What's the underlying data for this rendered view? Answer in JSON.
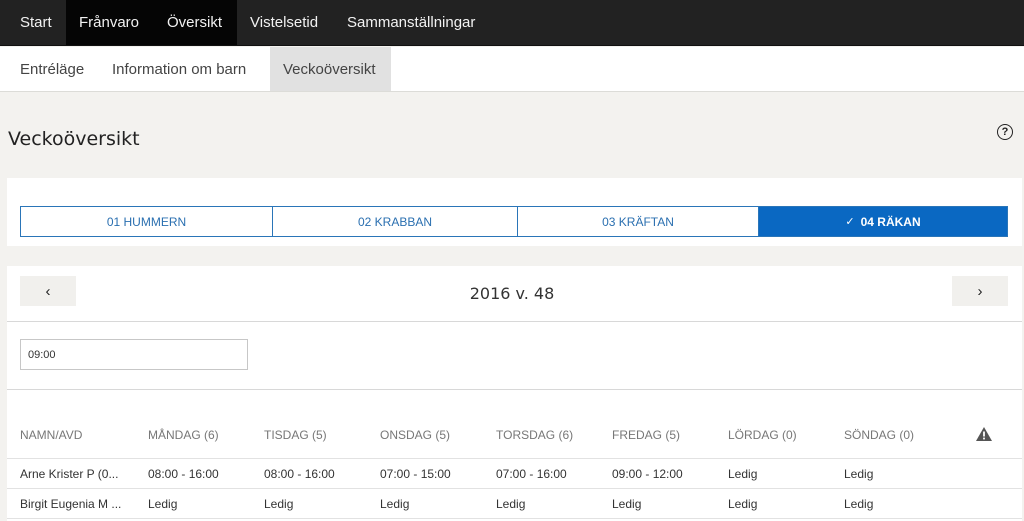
{
  "topnav": {
    "items": [
      {
        "label": "Start",
        "active": false
      },
      {
        "label": "Frånvaro",
        "active": true
      },
      {
        "label": "Översikt",
        "active": true
      },
      {
        "label": "Vistelsetid",
        "active": false
      },
      {
        "label": "Sammanställningar",
        "active": false
      }
    ]
  },
  "subnav": {
    "items": [
      {
        "label": "Entréläge",
        "active": false
      },
      {
        "label": "Information om barn",
        "active": false
      },
      {
        "label": "Veckoöversikt",
        "active": true
      }
    ]
  },
  "page": {
    "title": "Veckoöversikt",
    "help_icon": "question-circle-icon"
  },
  "groups": {
    "items": [
      {
        "label": "01 HUMMERN",
        "active": false
      },
      {
        "label": "02 KRABBAN",
        "active": false
      },
      {
        "label": "03 KRÄFTAN",
        "active": false
      },
      {
        "label": "04 RÄKAN",
        "active": true
      }
    ],
    "active_icon": "✓",
    "accent_color": "#0a68c2"
  },
  "week": {
    "label": "2016 v. 48",
    "prev_icon": "‹",
    "next_icon": "›"
  },
  "time_filter": {
    "value": "09:00"
  },
  "table": {
    "columns": [
      "NAMN/AVD",
      "MÅNDAG (6)",
      "TISDAG (5)",
      "ONSDAG (5)",
      "TORSDAG (6)",
      "FREDAG (5)",
      "LÖRDAG (0)",
      "SÖNDAG (0)"
    ],
    "warning_icon": "warning-triangle-icon",
    "rows": [
      [
        "Arne Krister P (0...",
        "08:00 - 16:00",
        "08:00 - 16:00",
        "07:00 - 15:00",
        "07:00 - 16:00",
        "09:00 - 12:00",
        "Ledig",
        "Ledig"
      ],
      [
        "Birgit Eugenia M ...",
        "Ledig",
        "Ledig",
        "Ledig",
        "Ledig",
        "Ledig",
        "Ledig",
        "Ledig"
      ]
    ]
  }
}
